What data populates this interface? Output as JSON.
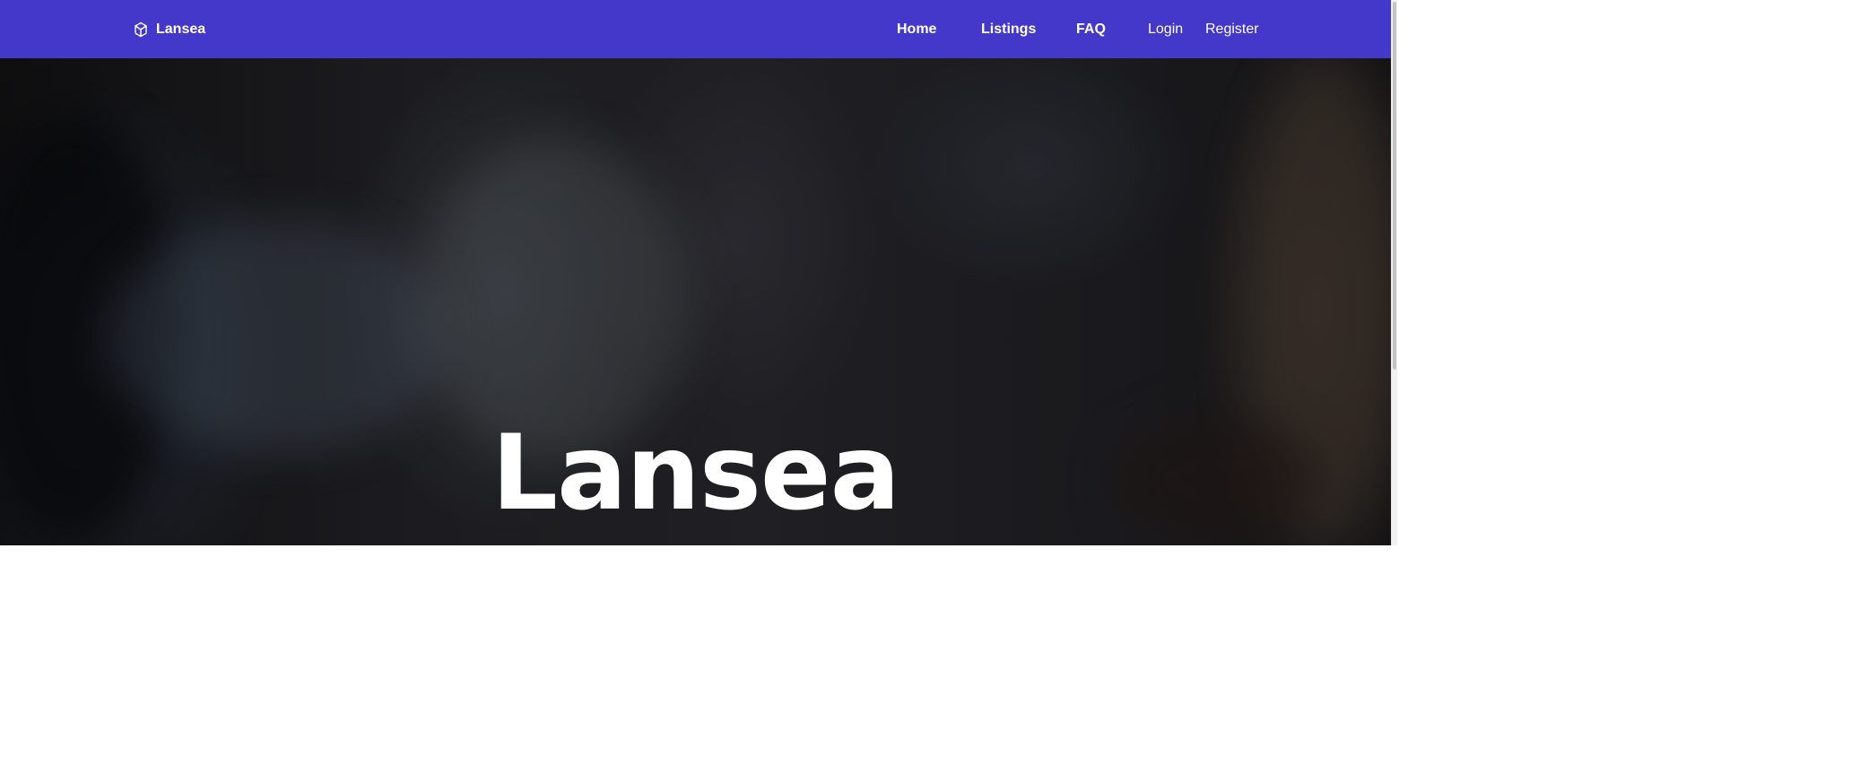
{
  "navbar": {
    "brand": "Lansea",
    "links": [
      {
        "label": "Home"
      },
      {
        "label": "Listings"
      },
      {
        "label": "FAQ"
      },
      {
        "label": "Login"
      },
      {
        "label": "Register"
      }
    ]
  },
  "hero": {
    "title": "Lansea"
  },
  "colors": {
    "navbar_bg": "#4338ca",
    "nav_text": "#ffffff",
    "hero_text": "#ffffff"
  },
  "icons": {
    "brand": "cube-icon"
  }
}
